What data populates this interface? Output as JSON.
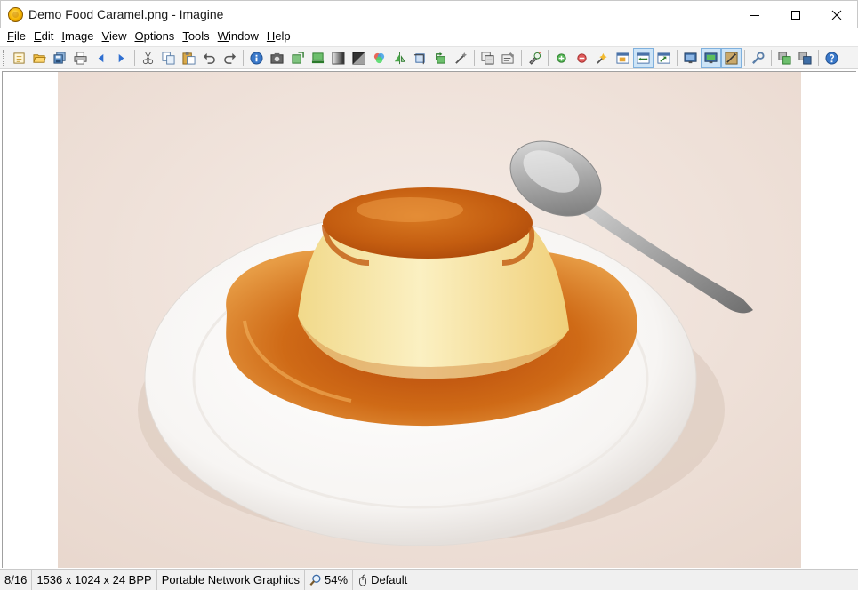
{
  "window": {
    "title": "Demo Food Caramel.png - Imagine",
    "controls": [
      "minimize-icon",
      "maximize-icon",
      "close-icon"
    ]
  },
  "menu": [
    {
      "label": "File",
      "accel": "F",
      "rest": "ile"
    },
    {
      "label": "Edit",
      "accel": "E",
      "rest": "dit"
    },
    {
      "label": "Image",
      "accel": "I",
      "rest": "mage"
    },
    {
      "label": "View",
      "accel": "V",
      "rest": "iew"
    },
    {
      "label": "Options",
      "accel": "O",
      "rest": "ptions"
    },
    {
      "label": "Tools",
      "accel": "T",
      "rest": "ools"
    },
    {
      "label": "Window",
      "accel": "W",
      "rest": "indow"
    },
    {
      "label": "Help",
      "accel": "H",
      "rest": "elp"
    }
  ],
  "toolbar": {
    "groups": [
      [
        "browse-folder-icon",
        "open-icon",
        "save-all-icon",
        "print-icon",
        "previous-icon",
        "next-icon"
      ],
      [
        "cut-icon",
        "copy-icon",
        "paste-icon",
        "undo-icon",
        "redo-icon"
      ],
      [
        "info-icon",
        "camera-icon",
        "resize-icon",
        "canvas-icon",
        "grayscale-icon",
        "negative-icon",
        "color-icon",
        "flip-icon",
        "crop-icon",
        "rotate-icon",
        "effects-icon"
      ],
      [
        "batch-convert-icon",
        "batch-rename-icon"
      ],
      [
        "screen-capture-icon"
      ],
      [
        "zoom-in-icon",
        "zoom-out-icon",
        "zoom-select-icon",
        "fit-window-icon",
        "fit-width-icon",
        "actual-size-icon"
      ],
      [
        "fullscreen-icon",
        "slideshow-icon",
        "thumbnail-icon"
      ],
      [
        "settings-icon"
      ],
      [
        "plugins-icon",
        "monitor-icon"
      ],
      [
        "help-icon"
      ]
    ],
    "active": [
      "fit-width-icon",
      "slideshow-icon",
      "thumbnail-icon"
    ]
  },
  "image": {
    "alt": "Caramel pudding on white plate with spoon"
  },
  "status": {
    "index": "8/16",
    "dimensions": "1536 x 1024 x 24 BPP",
    "format": "Portable Network Graphics",
    "zoom": "54%",
    "profile": "Default"
  }
}
